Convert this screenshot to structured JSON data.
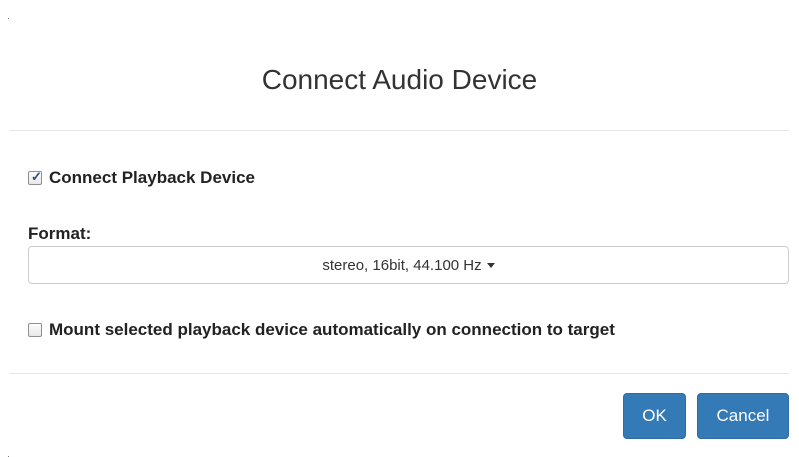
{
  "dialog": {
    "title": "Connect Audio Device"
  },
  "playback": {
    "label": "Connect Playback Device",
    "checked": true
  },
  "format": {
    "label": "Format:",
    "selected": "stereo, 16bit, 44.100 Hz"
  },
  "mount": {
    "label": "Mount selected playback device automatically on connection to target",
    "checked": false
  },
  "buttons": {
    "ok_label": "OK",
    "cancel_label": "Cancel"
  },
  "colors": {
    "primary": "#337ab7",
    "divider": "#e5e5e5"
  },
  "icons": {
    "checkmark": "checkmark-icon",
    "caret": "caret-down-icon"
  }
}
